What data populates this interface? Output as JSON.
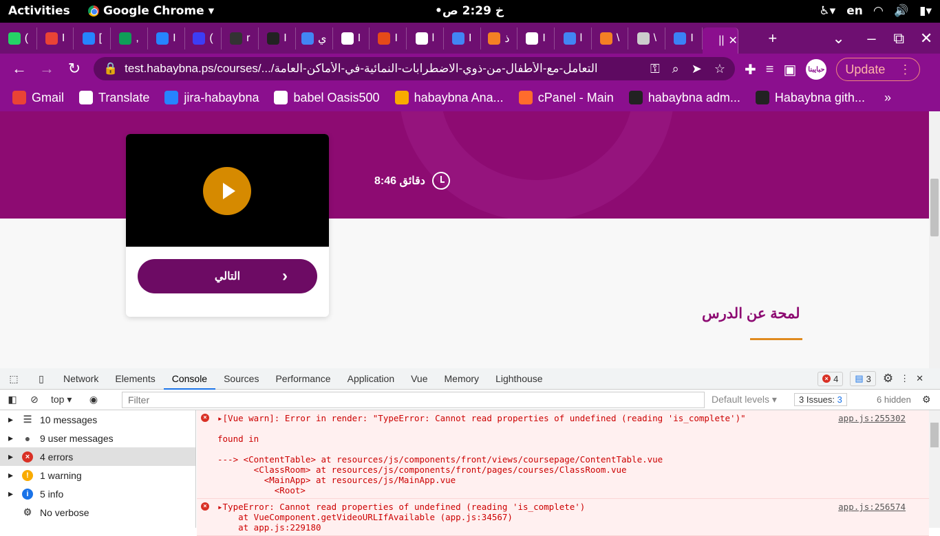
{
  "system": {
    "activities": "Activities",
    "app_name": "Google Chrome",
    "clock": "•خ 2:29 ص",
    "lang": "en"
  },
  "tabs": [
    {
      "label": "(",
      "color": "#25d366"
    },
    {
      "label": "I",
      "color": "#ea4335"
    },
    {
      "label": "[",
      "color": "#2684ff"
    },
    {
      "label": ",",
      "color": "#0f9d58"
    },
    {
      "label": "I",
      "color": "#2684ff"
    },
    {
      "label": "(",
      "color": "#3d3df5"
    },
    {
      "label": "r",
      "color": "#333333"
    },
    {
      "label": "I",
      "color": "#222222"
    },
    {
      "label": "ي",
      "color": "#4285f4"
    },
    {
      "label": "I",
      "color": "#ffffff"
    },
    {
      "label": "I",
      "color": "#e64a19"
    },
    {
      "label": "l",
      "color": "#ffffff"
    },
    {
      "label": "I",
      "color": "#4285f4"
    },
    {
      "label": "ذ",
      "color": "#f48024"
    },
    {
      "label": "I",
      "color": "#ffffff"
    },
    {
      "label": "l",
      "color": "#4285f4"
    },
    {
      "label": "\\",
      "color": "#f48024"
    },
    {
      "label": "\\",
      "color": "#cccccc"
    },
    {
      "label": "I",
      "color": "#3b82f6"
    },
    {
      "label": "||",
      "color": "#8b0f8e"
    }
  ],
  "toolbar": {
    "url": "test.habaybna.ps/courses/.../التعامل-مع-الأطفال-من-ذوي-الاضطرابات-النمائية-في-الأماكن-العامة",
    "update_label": "Update",
    "avatar_text": "حبايبنا"
  },
  "bookmarks": [
    {
      "label": "Gmail",
      "color": "#ea4335"
    },
    {
      "label": "Translate",
      "color": "#ffffff"
    },
    {
      "label": "jira-habaybna",
      "color": "#2684ff"
    },
    {
      "label": "babel Oasis500",
      "color": "#ffffff"
    },
    {
      "label": "habaybna Ana...",
      "color": "#f9ab00"
    },
    {
      "label": "cPanel - Main",
      "color": "#ff6c2c"
    },
    {
      "label": "habaybna adm...",
      "color": "#222222"
    },
    {
      "label": "Habaybna gith...",
      "color": "#222222"
    }
  ],
  "page": {
    "duration": "8:46 دقائق",
    "next_label": "التالي",
    "overview_title": "لمحة عن الدرس"
  },
  "devtools": {
    "tabs": [
      "Network",
      "Elements",
      "Console",
      "Sources",
      "Performance",
      "Application",
      "Vue",
      "Memory",
      "Lighthouse"
    ],
    "active_tab": "Console",
    "error_count": "4",
    "message_count": "3",
    "context": "top",
    "filter_placeholder": "Filter",
    "levels": "Default levels",
    "issues_label": "3 Issues:",
    "issues_count": "3",
    "hidden": "6 hidden",
    "sidebar": [
      {
        "label": "10 messages",
        "icon": "list-icon"
      },
      {
        "label": "9 user messages",
        "icon": "user-icon"
      },
      {
        "label": "4 errors",
        "icon": "error-icon"
      },
      {
        "label": "1 warning",
        "icon": "warning-icon"
      },
      {
        "label": "5 info",
        "icon": "info-icon"
      },
      {
        "label": "No verbose",
        "icon": "gear-icon"
      }
    ],
    "entries": [
      {
        "text": "▸[Vue warn]: Error in render: \"TypeError: Cannot read properties of undefined (reading 'is_complete')\"\n\nfound in\n\n---> <ContentTable> at resources/js/components/front/views/coursepage/ContentTable.vue\n       <ClassRoom> at resources/js/components/front/pages/courses/ClassRoom.vue\n         <MainApp> at resources/js/MainApp.vue\n           <Root>",
        "source": "app.js:255302"
      },
      {
        "text": "▸TypeError: Cannot read properties of undefined (reading 'is_complete')\n    at VueComponent.getVideoURLIfAvailable (app.js:34567)\n    at app.js:229180",
        "source": "app.js:256574"
      }
    ]
  }
}
